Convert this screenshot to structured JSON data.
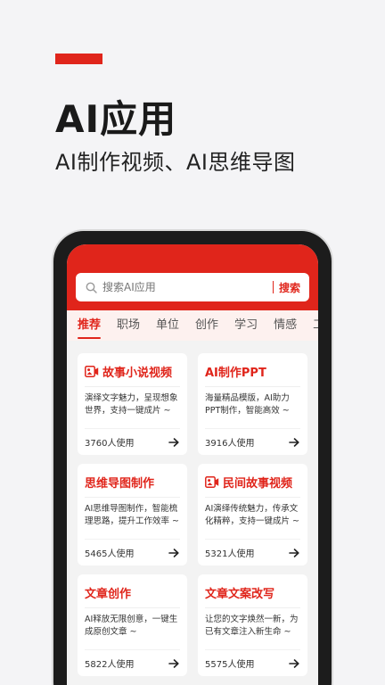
{
  "promo": {
    "title": "AI应用",
    "subtitle": "AI制作视频、AI思维导图"
  },
  "search": {
    "placeholder": "搜索AI应用",
    "button_label": "搜索"
  },
  "tabs": [
    {
      "label": "推荐",
      "active": true
    },
    {
      "label": "职场",
      "active": false
    },
    {
      "label": "单位",
      "active": false
    },
    {
      "label": "创作",
      "active": false
    },
    {
      "label": "学习",
      "active": false
    },
    {
      "label": "情感",
      "active": false
    },
    {
      "label": "工具",
      "active": false
    }
  ],
  "cards": [
    {
      "title": "故事小说视频",
      "icon": "video-icon",
      "desc": "演绎文字魅力，呈现想象世界，支持一键成片 ~",
      "usage": "3760人使用"
    },
    {
      "title": "AI制作PPT",
      "icon": "",
      "desc": "海量精品模版，AI助力PPT制作，智能高效 ~",
      "usage": "3916人使用"
    },
    {
      "title": "思维导图制作",
      "icon": "",
      "desc": "AI思维导图制作，智能梳理思路，提升工作效率 ~",
      "usage": "5465人使用"
    },
    {
      "title": "民间故事视频",
      "icon": "video-icon",
      "desc": "AI演绎传统魅力，传承文化精粹，支持一键成片 ~",
      "usage": "5321人使用"
    },
    {
      "title": "文章创作",
      "icon": "",
      "desc": "AI释放无限创意，一键生成原创文章 ~",
      "usage": "5822人使用"
    },
    {
      "title": "文章文案改写",
      "icon": "",
      "desc": "让您的文字焕然一新，为已有文章注入新生命 ~",
      "usage": "5575人使用"
    }
  ],
  "colors": {
    "accent": "#e0251b",
    "background": "#f4f4f6",
    "tab_bar": "#fdf1ef"
  }
}
